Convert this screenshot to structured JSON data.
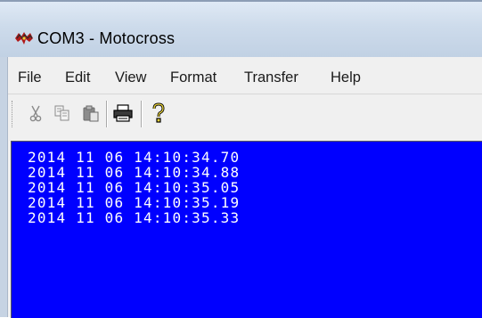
{
  "window": {
    "title": "COM3 - Motocross",
    "icon": "hyperterminal-app-icon"
  },
  "menu": {
    "items": [
      "File",
      "Edit",
      "View",
      "Format",
      "Transfer",
      "Help"
    ]
  },
  "toolbar": {
    "buttons": [
      {
        "name": "cut-icon",
        "glyph": "✂"
      },
      {
        "name": "copy-icon",
        "glyph": "copy"
      },
      {
        "name": "paste-icon",
        "glyph": "paste"
      },
      {
        "name": "print-icon",
        "glyph": "printer"
      },
      {
        "name": "help-icon",
        "glyph": "?"
      }
    ]
  },
  "terminal": {
    "background": "#0000ff",
    "foreground": "#ffffff",
    "lines": [
      "2014 11 06 14:10:34.70",
      "2014 11 06 14:10:34.88",
      "2014 11 06 14:10:35.05",
      "2014 11 06 14:10:35.19",
      "2014 11 06 14:10:35.33"
    ]
  }
}
